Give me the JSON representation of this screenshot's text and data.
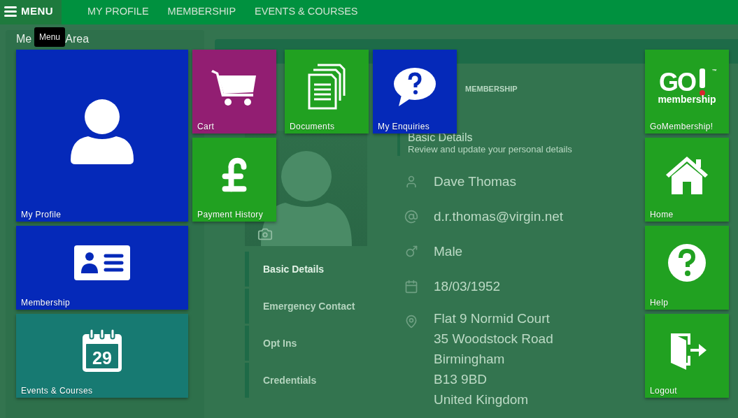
{
  "top_bar": {
    "menu_button": "MENU",
    "links": [
      "MY PROFILE",
      "MEMBERSHIP",
      "EVENTS & COURSES"
    ]
  },
  "tooltip": "Menu",
  "page_title": [
    "Me",
    "Area"
  ],
  "panel": {
    "breadcrumb": "MEMBERSHIP",
    "section_title": "Basic Details",
    "section_subtitle": "Review and update your personal details",
    "nav": [
      {
        "label": "Basic Details",
        "selected": true
      },
      {
        "label": "Emergency Contact",
        "selected": false
      },
      {
        "label": "Opt Ins",
        "selected": false
      },
      {
        "label": "Credentials",
        "selected": false
      }
    ],
    "details": [
      {
        "kind": "person",
        "lines": [
          "Dave Thomas"
        ]
      },
      {
        "kind": "email",
        "lines": [
          "d.r.thomas@virgin.net"
        ]
      },
      {
        "kind": "gender",
        "lines": [
          "Male"
        ]
      },
      {
        "kind": "date",
        "lines": [
          "18/03/1952"
        ]
      },
      {
        "kind": "address",
        "lines": [
          "Flat 9 Normid Court",
          "35 Woodstock Road",
          "Birmingham",
          "B13 9BD",
          "United Kingdom"
        ]
      }
    ]
  },
  "tiles_left": [
    {
      "label": "My Profile",
      "kind": "person",
      "color": "#0529b9"
    },
    {
      "label": "Cart",
      "kind": "cart",
      "color": "#921e72"
    },
    {
      "label": "Documents",
      "kind": "documents",
      "color": "#21a121"
    },
    {
      "label": "My Enquiries",
      "kind": "question-bubble",
      "color": "#0529b9"
    },
    {
      "label": "Payment History",
      "kind": "pound",
      "color": "#21a121"
    },
    {
      "label": "Membership",
      "kind": "id-card",
      "color": "#0529b9"
    },
    {
      "label": "Events & Courses",
      "kind": "calendar",
      "color": "#177a72",
      "icon_text": "29"
    }
  ],
  "tiles_right": [
    {
      "label": "GoMembership!",
      "kind": "logo",
      "color": "#21a121",
      "logo": {
        "main": "GO",
        "sub": "membership",
        "mark": "™"
      }
    },
    {
      "label": "Home",
      "kind": "home",
      "color": "#21a121"
    },
    {
      "label": "Help",
      "kind": "help",
      "color": "#21a121"
    },
    {
      "label": "Logout",
      "kind": "exit",
      "color": "#21a121"
    }
  ]
}
